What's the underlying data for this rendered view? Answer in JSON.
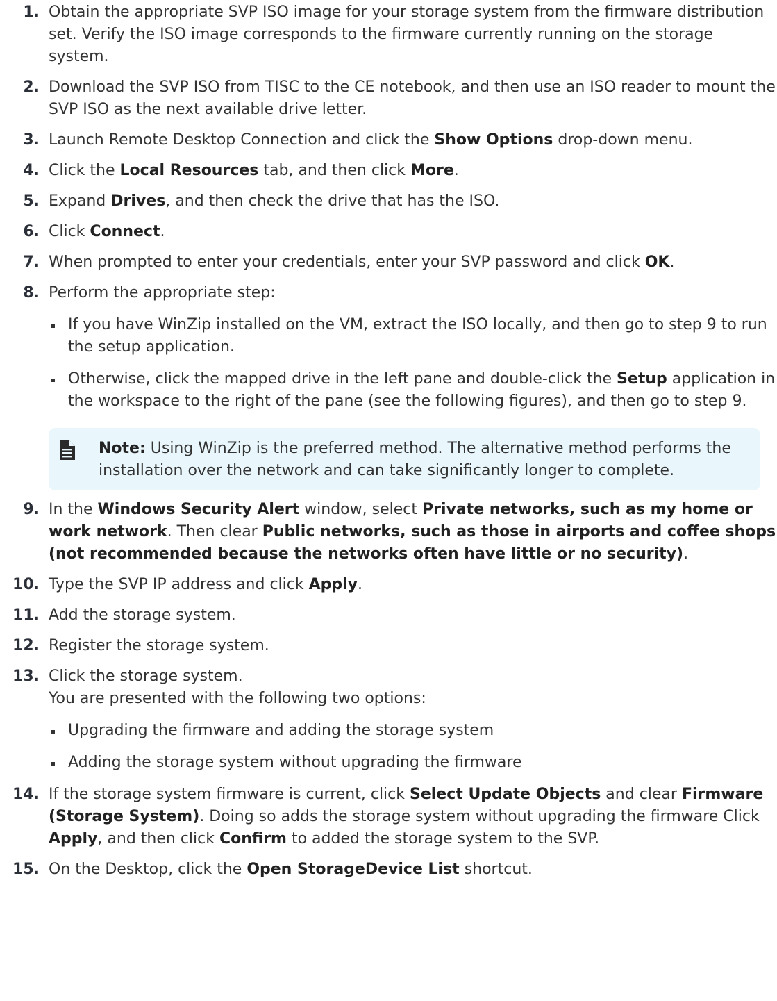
{
  "steps": [
    {
      "num": "1.",
      "segments": [
        {
          "t": "Obtain the appropriate SVP ISO image for your storage system from the firmware distribution set. Verify the ISO image corresponds to the firmware currently running on the storage system."
        }
      ]
    },
    {
      "num": "2.",
      "segments": [
        {
          "t": "Download the SVP ISO from TISC to the CE notebook, and then use an ISO reader to mount the SVP ISO as the next available drive letter."
        }
      ]
    },
    {
      "num": "3.",
      "segments": [
        {
          "t": "Launch Remote Desktop Connection and click the "
        },
        {
          "t": "Show Options",
          "b": true
        },
        {
          "t": " drop-down menu."
        }
      ]
    },
    {
      "num": "4.",
      "segments": [
        {
          "t": "Click the "
        },
        {
          "t": "Local Resources",
          "b": true
        },
        {
          "t": " tab, and then click "
        },
        {
          "t": "More",
          "b": true
        },
        {
          "t": "."
        }
      ]
    },
    {
      "num": "5.",
      "segments": [
        {
          "t": "Expand "
        },
        {
          "t": "Drives",
          "b": true
        },
        {
          "t": ", and then check the drive that has the ISO."
        }
      ]
    },
    {
      "num": "6.",
      "segments": [
        {
          "t": "Click "
        },
        {
          "t": "Connect",
          "b": true
        },
        {
          "t": "."
        }
      ]
    },
    {
      "num": "7.",
      "segments": [
        {
          "t": "When prompted to enter your credentials, enter your SVP password and click "
        },
        {
          "t": "OK",
          "b": true
        },
        {
          "t": "."
        }
      ]
    },
    {
      "num": "8.",
      "segments": [
        {
          "t": "Perform the appropriate step:"
        }
      ],
      "bullets": [
        [
          {
            "t": "If you have WinZip installed on the VM, extract the ISO locally, and then go to step 9 to run the setup application."
          }
        ],
        [
          {
            "t": "Otherwise, click the mapped drive in the left pane and double-click the "
          },
          {
            "t": "Setup",
            "b": true
          },
          {
            "t": " application in the workspace to the right of the pane (see the following figures), and then go to step 9."
          }
        ]
      ],
      "note": {
        "icon": "note-document-icon",
        "label": "Note:",
        "text": " Using WinZip is the preferred method. The alternative method performs the installation over the network and can take significantly longer to complete."
      }
    },
    {
      "num": "9.",
      "segments": [
        {
          "t": "In the "
        },
        {
          "t": "Windows Security Alert",
          "b": true
        },
        {
          "t": " window, select "
        },
        {
          "t": "Private networks, such as my home or work network",
          "b": true
        },
        {
          "t": ". Then clear "
        },
        {
          "t": "Public networks, such as those in airports and coffee shops (not recommended because the networks often have little or no security)",
          "b": true
        },
        {
          "t": "."
        }
      ]
    },
    {
      "num": "10.",
      "segments": [
        {
          "t": "Type the SVP IP address and click "
        },
        {
          "t": "Apply",
          "b": true
        },
        {
          "t": "."
        }
      ]
    },
    {
      "num": "11.",
      "segments": [
        {
          "t": "Add the storage system."
        }
      ]
    },
    {
      "num": "12.",
      "segments": [
        {
          "t": "Register the storage system."
        }
      ]
    },
    {
      "num": "13.",
      "segments": [
        {
          "t": "Click the storage system."
        }
      ],
      "subline": "You are presented with the following two options:",
      "bullets": [
        [
          {
            "t": "Upgrading the firmware and adding the storage system"
          }
        ],
        [
          {
            "t": "Adding the storage system without upgrading the firmware"
          }
        ]
      ]
    },
    {
      "num": "14.",
      "segments": [
        {
          "t": "If the storage system firmware is current, click "
        },
        {
          "t": "Select Update Objects",
          "b": true
        },
        {
          "t": " and clear "
        },
        {
          "t": "Firmware (Storage System)",
          "b": true
        },
        {
          "t": ". Doing so adds the storage system without upgrading the firmware Click "
        },
        {
          "t": "Apply",
          "b": true
        },
        {
          "t": ", and then click "
        },
        {
          "t": "Confirm",
          "b": true
        },
        {
          "t": " to added the storage system to the SVP."
        }
      ]
    },
    {
      "num": "15.",
      "segments": [
        {
          "t": "On the Desktop, click the "
        },
        {
          "t": "Open StorageDevice List",
          "b": true
        },
        {
          "t": " shortcut."
        }
      ]
    }
  ]
}
